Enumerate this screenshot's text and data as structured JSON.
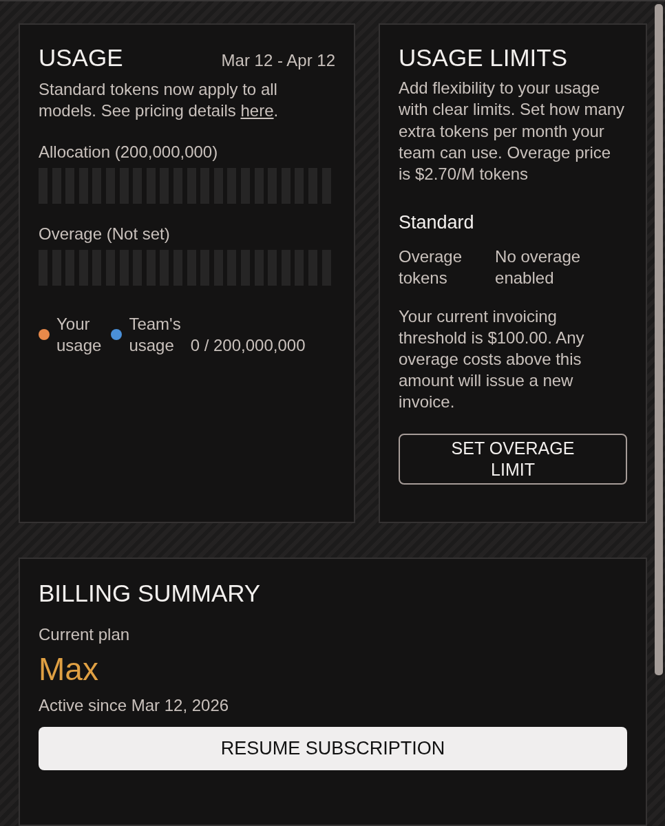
{
  "usage": {
    "title": "USAGE",
    "date_range": "Mar 12 - Apr 12",
    "description": "Standard tokens now apply to all models. See pricing details ",
    "link": "here",
    "after_link": ".",
    "meters": [
      {
        "label": "Allocation (200,000,000)",
        "level": 0
      },
      {
        "label": "Overage (Not set)",
        "level": 0
      }
    ],
    "legend": [
      {
        "label": "Your usage",
        "color": "#e8894a"
      },
      {
        "label": "Team's usage",
        "color": "#4a90d9"
      }
    ],
    "total": "0 / 200,000,000"
  },
  "usage_limits": {
    "title": "USAGE LIMITS",
    "description": "Add flexibility to your usage with clear limits. Set how many extra tokens per month your team can use. Overage price is $2.70/M tokens",
    "section_title": "Standard",
    "rows": [
      {
        "label": "Overage tokens",
        "value": "No overage enabled"
      }
    ],
    "note": "Your current invoicing threshold is $100.00. Any overage costs above this amount will issue a new invoice.",
    "button": "SET OVERAGE LIMIT"
  },
  "billing": {
    "title": "BILLING SUMMARY",
    "plan_label": "Current plan",
    "plan_name": "Max",
    "active_since": "Active since Mar 12, 2026",
    "button": "RESUME SUBSCRIPTION"
  }
}
